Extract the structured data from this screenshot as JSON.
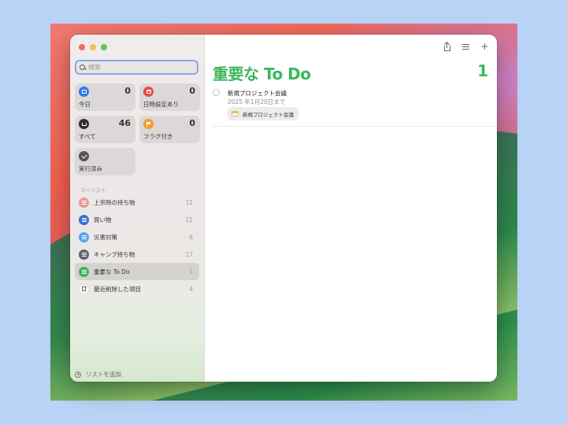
{
  "window": {
    "title": "重要な To Do"
  },
  "search": {
    "placeholder": "検索"
  },
  "smart_lists": [
    {
      "id": "today",
      "label": "今日",
      "count": "0",
      "color": "#2f7be7",
      "icon": "calendar-icon"
    },
    {
      "id": "scheduled",
      "label": "日時設定あり",
      "count": "0",
      "color": "#e84a4a",
      "icon": "calendar-grid-icon"
    },
    {
      "id": "all",
      "label": "すべて",
      "count": "46",
      "color": "#2e2e2e",
      "icon": "tray-icon"
    },
    {
      "id": "flagged",
      "label": "フラグ付き",
      "count": "0",
      "color": "#f39b2b",
      "icon": "flag-icon"
    },
    {
      "id": "completed",
      "label": "実行済み",
      "count": "",
      "color": "#555555",
      "icon": "checkmark-icon"
    }
  ],
  "my_lists_label": "マイリスト",
  "my_lists": [
    {
      "name": "上京時の持ち物",
      "count": "11",
      "color": "#e79a9a"
    },
    {
      "name": "買い物",
      "count": "11",
      "color": "#3a6fd6"
    },
    {
      "name": "災害対策",
      "count": "6",
      "color": "#58a6e8"
    },
    {
      "name": "キャンプ持ち物",
      "count": "17",
      "color": "#5b6470"
    },
    {
      "name": "重要な To Do",
      "count": "1",
      "color": "#3cb85b",
      "selected": true
    },
    {
      "name": "最近削除した項目",
      "count": "4",
      "color": "#ffffff",
      "icon": "trash-icon"
    }
  ],
  "add_list_label": "リストを追加",
  "main": {
    "title": "重要な To Do",
    "count": "1",
    "accent": "#3cb85b",
    "todos": [
      {
        "title": "新規プロジェクト会議",
        "due": "2025 年1月20日まで",
        "tag": "新規プロジェクト会議"
      }
    ]
  }
}
